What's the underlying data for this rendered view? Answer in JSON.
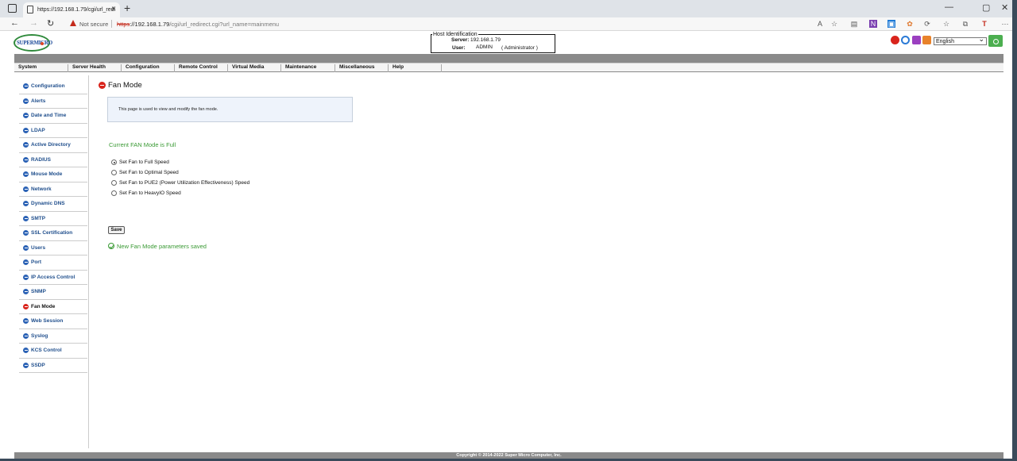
{
  "browser": {
    "tab_title": "https://192.168.1.79/cgi/url_redi",
    "not_secure": "Not secure",
    "url_scheme": "https",
    "url_host": "://192.168.1.79",
    "url_path": "/cgi/url_redirect.cgi?url_name=mainmenu"
  },
  "header": {
    "logo_text": "SUPERMICRO",
    "host_id_legend": "Host Identification",
    "server_label": "Server:",
    "server_value": "192.168.1.79",
    "user_label": "User:",
    "user_value": "ADMIN",
    "user_role": "( Administrator )",
    "language": "English"
  },
  "menu": [
    "System",
    "Server Health",
    "Configuration",
    "Remote Control",
    "Virtual Media",
    "Maintenance",
    "Miscellaneous",
    "Help"
  ],
  "sidebar": [
    "Configuration",
    "Alerts",
    "Date and Time",
    "LDAP",
    "Active Directory",
    "RADIUS",
    "Mouse Mode",
    "Network",
    "Dynamic DNS",
    "SMTP",
    "SSL Certification",
    "Users",
    "Port",
    "IP Access Control",
    "SNMP",
    "Fan Mode",
    "Web Session",
    "Syslog",
    "KCS Control",
    "SSDP"
  ],
  "sidebar_active": "Fan Mode",
  "main": {
    "title": "Fan Mode",
    "info": "This page is used to view and modify the fan mode.",
    "current_mode": "Current FAN Mode is Full",
    "options": [
      "Set Fan to Full Speed",
      "Set Fan to Optimal Speed",
      "Set Fan to PUE2 (Power Utilization Effectiveness) Speed",
      "Set Fan to HeavyIO Speed"
    ],
    "selected_option": 0,
    "save_label": "Save",
    "saved_message": "New Fan Mode parameters saved"
  },
  "footer": "Copyright © 2014-2022 Super Micro Computer, Inc.",
  "colors": {
    "accent_green": "#3a9a34",
    "link_blue": "#1f4e8c",
    "active_red": "#d9241c",
    "band_gray": "#8a8a8a"
  }
}
